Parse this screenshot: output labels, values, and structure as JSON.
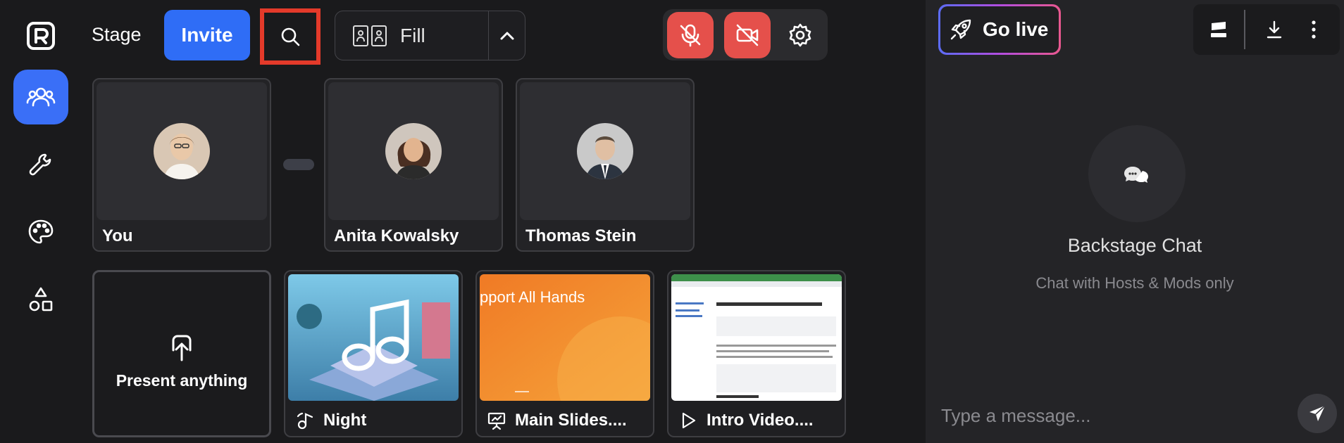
{
  "header": {
    "stage_label": "Stage",
    "invite_label": "Invite",
    "layout_label": "Fill"
  },
  "participants": [
    {
      "name": "You"
    },
    {
      "name": "Anita Kowalsky"
    },
    {
      "name": "Thomas Stein"
    }
  ],
  "media": {
    "present_label": "Present anything",
    "items": [
      {
        "label": "Night",
        "icon": "audio-icon"
      },
      {
        "label": "Main Slides....",
        "icon": "presentation-icon",
        "slide_text": "pport All Hands"
      },
      {
        "label": "Intro Video....",
        "icon": "play-icon"
      }
    ]
  },
  "right_panel": {
    "go_live_label": "Go live",
    "chat_title": "Backstage Chat",
    "chat_subtitle": "Chat with Hosts & Mods only",
    "message_placeholder": "Type a message..."
  },
  "colors": {
    "accent": "#2f6df6",
    "danger": "#e5504b",
    "highlight_border": "#e43a2a"
  }
}
